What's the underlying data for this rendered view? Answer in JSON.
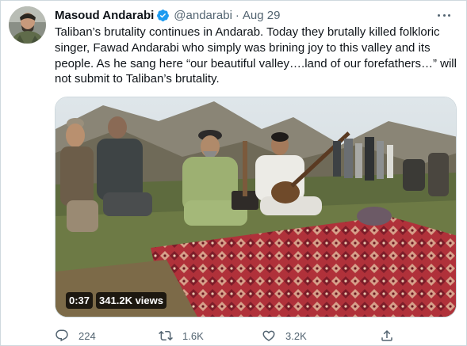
{
  "author": {
    "display_name": "Masoud Andarabi",
    "handle": "@andarabi",
    "separator": "·",
    "timestamp": "Aug 29",
    "verified": true,
    "avatar_icon": "profile-photo"
  },
  "tweet": {
    "lines": [
      "Taliban’s brutality continues in Andarab. Today they brutally killed folkloric",
      "singer, Fawad Andarabi who simply was brining joy to this valley and its",
      "people. As he sang here “our beautiful valley….land of our forefathers…” will",
      "not submit to Taliban’s brutality."
    ]
  },
  "video": {
    "duration": "0:37",
    "views": "341.2K views"
  },
  "actions": {
    "reply_count": "224",
    "retweet_count": "1.6K",
    "like_count": "3.2K",
    "reply_icon": "reply-icon",
    "retweet_icon": "retweet-icon",
    "like_icon": "heart-icon",
    "share_icon": "share-icon"
  },
  "colors": {
    "verified_blue": "#1d9bf0",
    "secondary_text": "#536471",
    "primary_text": "#0f1419"
  }
}
